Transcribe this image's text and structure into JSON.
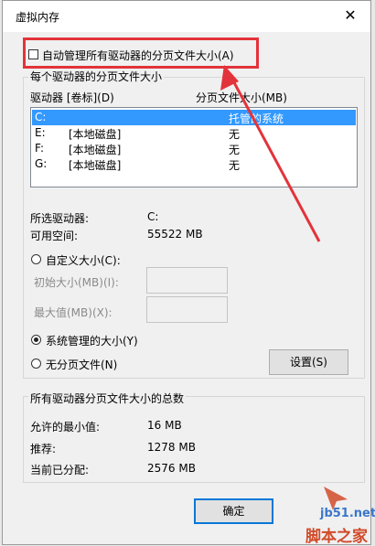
{
  "window": {
    "title": "虚拟内存",
    "close_glyph": "✕"
  },
  "auto_manage": {
    "label": "自动管理所有驱动器的分页文件大小(A)",
    "checked": false
  },
  "drives_group": {
    "label": "每个驱动器的分页文件大小",
    "col_drive": "驱动器 [卷标](D)",
    "col_size": "分页文件大小(MB)",
    "rows": [
      {
        "drive": "C:",
        "label": "",
        "size": "托管的系统",
        "selected": true
      },
      {
        "drive": "E:",
        "label": "[本地磁盘]",
        "size": "无",
        "selected": false
      },
      {
        "drive": "F:",
        "label": "[本地磁盘]",
        "size": "无",
        "selected": false
      },
      {
        "drive": "G:",
        "label": "[本地磁盘]",
        "size": "无",
        "selected": false
      }
    ],
    "selected_drive_label": "所选驱动器:",
    "selected_drive_value": "C:",
    "free_space_label": "可用空间:",
    "free_space_value": "55522 MB",
    "custom_size": "自定义大小(C):",
    "initial_size": "初始大小(MB)(I):",
    "max_size": "最大值(MB)(X):",
    "system_managed": "系统管理的大小(Y)",
    "no_paging": "无分页文件(N)",
    "set_button": "设置(S)"
  },
  "totals_group": {
    "label": "所有驱动器分页文件大小的总数",
    "min_label": "允许的最小值:",
    "min_value": "16 MB",
    "recommended_label": "推荐:",
    "recommended_value": "1278 MB",
    "current_label": "当前已分配:",
    "current_value": "2576 MB"
  },
  "ok_button": "确定",
  "watermark": {
    "line1": "jb51.net",
    "line2": "脚本之家"
  },
  "colors": {
    "annotation": "#e3333a",
    "selection": "#3399ff"
  }
}
